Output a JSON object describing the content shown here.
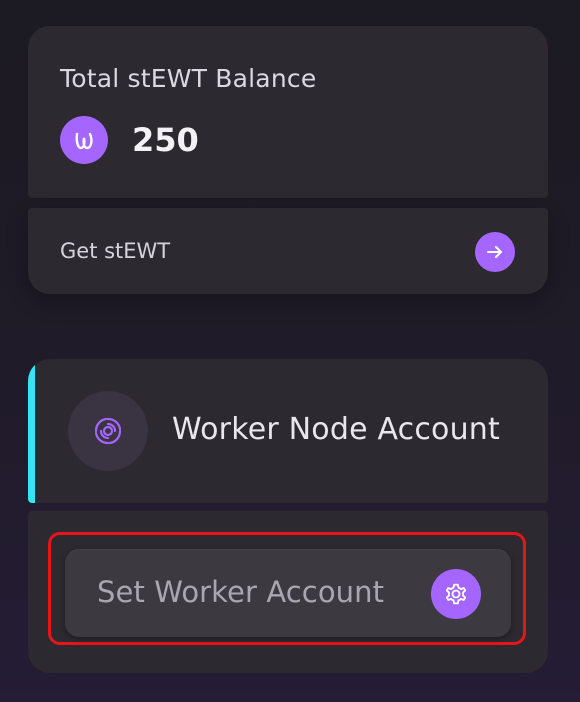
{
  "balance": {
    "title": "Total stEWT Balance",
    "value": "250",
    "token_icon": "ewt-token-icon",
    "get_label": "Get stEWT",
    "action_icon": "arrow-right-icon"
  },
  "worker": {
    "title": "Worker Node Account",
    "icon": "worker-node-icon",
    "set_button_label": "Set Worker Account",
    "set_button_icon": "gear-icon"
  },
  "colors": {
    "accent": "#a566ff",
    "card": "#2c2930",
    "cyan_indicator": "#35e5f4",
    "highlight": "#e8141c"
  }
}
